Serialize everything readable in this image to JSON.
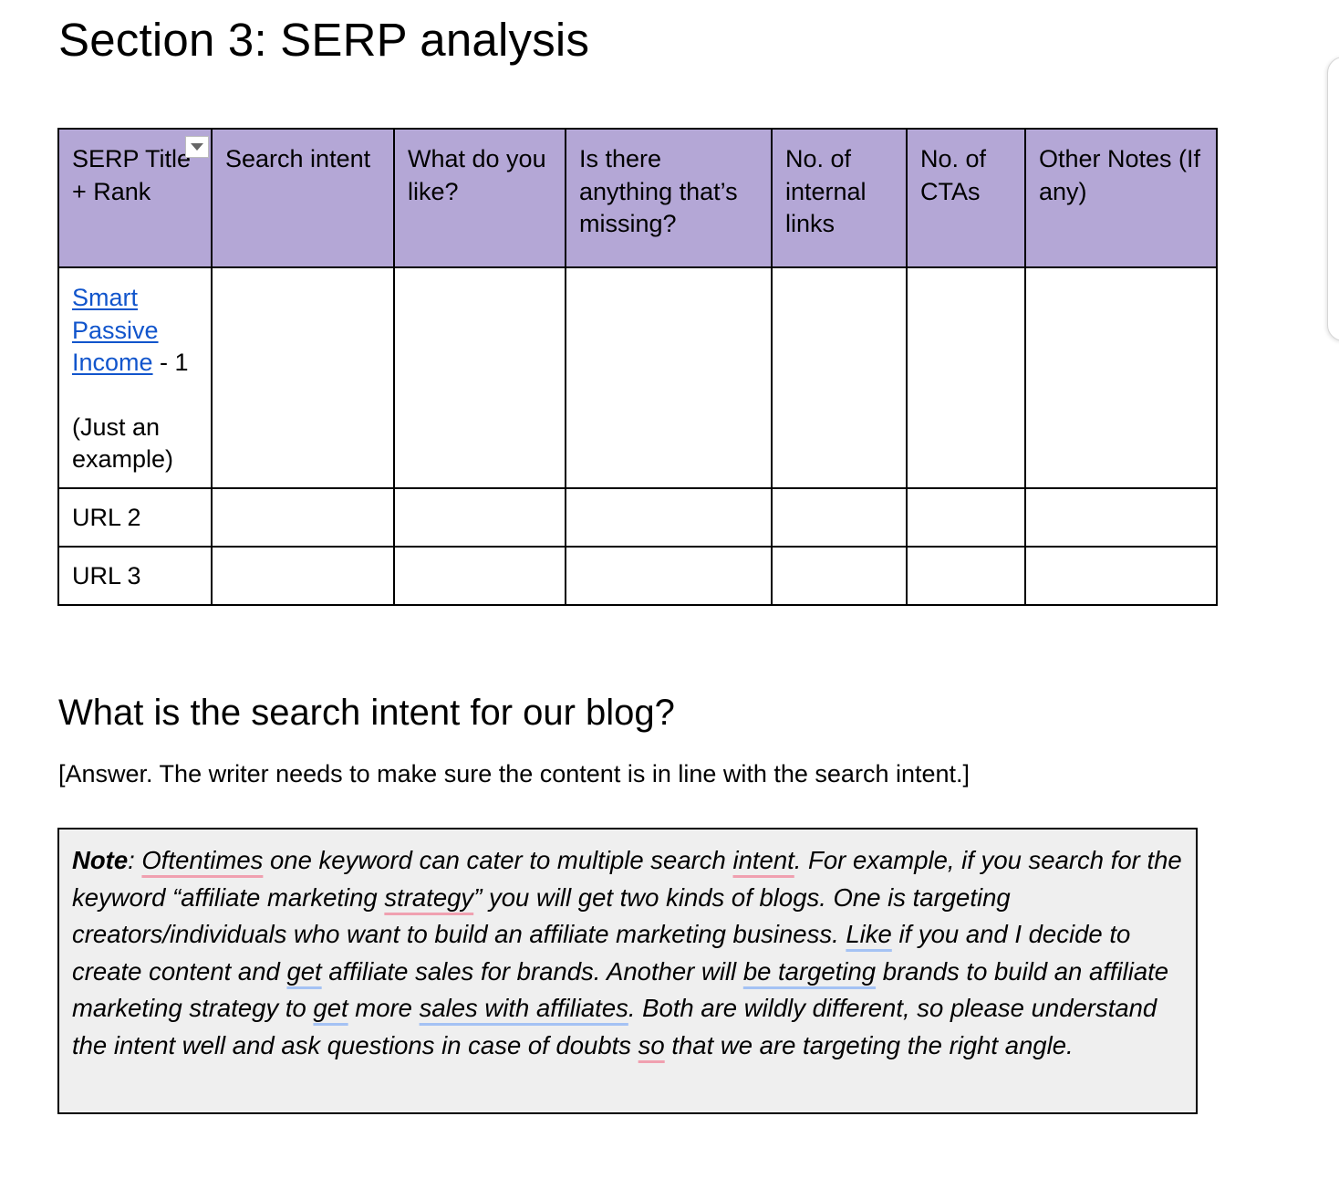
{
  "page_title": "Section 3: SERP analysis",
  "table": {
    "headers": [
      "SERP Title + Rank",
      "Search intent",
      "What do you like?",
      "Is there anything that’s missing?",
      "No. of internal links",
      "No. of CTAs",
      "Other Notes (If any)"
    ],
    "row1": {
      "link_text": "Smart Passive Income",
      "rank_text": " - 1",
      "example_note": "(Just an example)"
    },
    "row2_label": "URL 2",
    "row3_label": "URL 3"
  },
  "section_heading": "What is the search intent for our blog?",
  "answer_placeholder": "[Answer. The writer needs to make sure the content is in line with the search intent.]",
  "note": {
    "label": "Note",
    "s1": ": ",
    "w_oftentimes": "Oftentimes",
    "s2": " one keyword can cater to multiple search ",
    "w_intent": "intent",
    "s3": ". For example, if you search for the keyword “affiliate marketing ",
    "w_strategy": "strategy",
    "s4": "” you will get two kinds of blogs. One is targeting creators/individuals who want to build an affiliate marketing business. ",
    "w_like": "Like",
    "s5": " if you and I decide to create content and ",
    "w_get1": "get",
    "s6": " affiliate sales for brands. Another will ",
    "w_be_targeting": "be targeting",
    "s7": " brands to build an affiliate marketing strategy to ",
    "w_get2": "get",
    "s8": " more ",
    "w_sales": "sales with affiliates",
    "s9": ". Both are wildly different, so please understand the intent well and ask questions in case of doubts ",
    "w_so": "so",
    "s10": " that we are targeting the right angle."
  },
  "colors": {
    "header_bg": "#b4a7d6",
    "link": "#1155cc",
    "note_bg": "#efefef",
    "spelling_underline": "#f0a0b0",
    "grammar_underline": "#a4c2f4"
  }
}
